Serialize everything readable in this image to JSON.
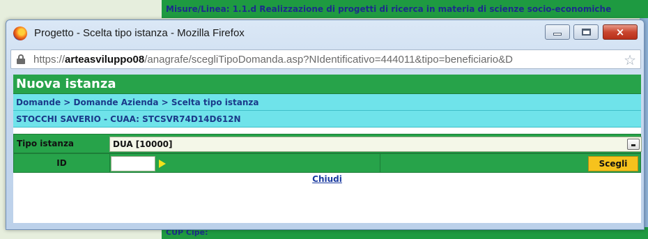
{
  "background": {
    "top_text": "Misure/Linea: 1.1.d Realizzazione di progetti di ricerca in materia di scienze socio-economiche",
    "bottom_text": "CUP Cipe:"
  },
  "window": {
    "title": "Progetto - Scelta tipo istanza - Mozilla Firefox",
    "url_prefix": "https://",
    "url_host": "arteasviluppo08",
    "url_path": "/anagrafe/scegliTipoDomanda.asp?NIdentificativo=444011&tipo=beneficiario&D",
    "buttons": {
      "minimize": "minimize",
      "maximize": "maximize",
      "close": "×"
    }
  },
  "page": {
    "heading": "Nuova istanza",
    "breadcrumb": "Domande > Domande Azienda > Scelta tipo istanza",
    "subject": "STOCCHI SAVERIO - CUAA: STCSVR74D14D612N",
    "form": {
      "tipo_label": "Tipo istanza",
      "tipo_value": "DUA [10000]",
      "id_label": "ID",
      "id_value": "",
      "submit_label": "Scegli"
    },
    "close_link": "Chiudi"
  },
  "colors": {
    "green": "#27a34a",
    "cyan": "#6fe3ea",
    "button_yellow": "#f6c21d",
    "link_blue": "#1a3aa0"
  }
}
